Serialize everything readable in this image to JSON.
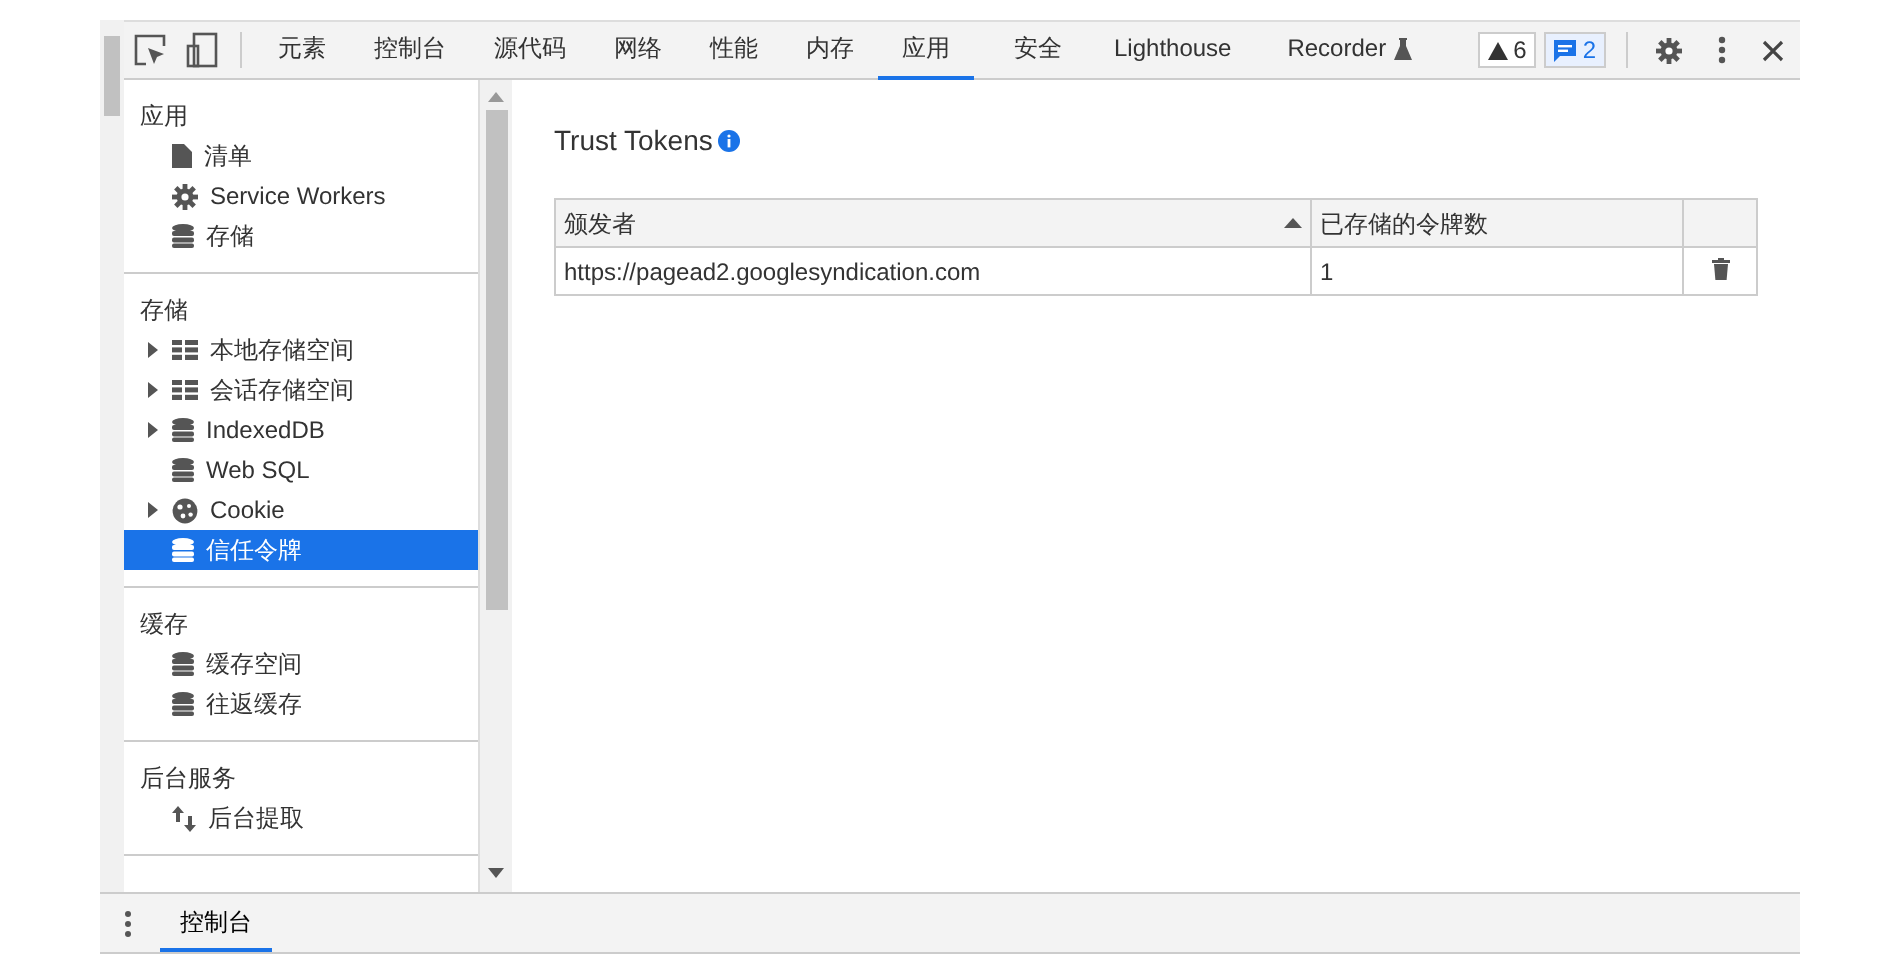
{
  "toolbar": {
    "tabs": [
      {
        "label": "元素",
        "selected": false
      },
      {
        "label": "控制台",
        "selected": false
      },
      {
        "label": "源代码",
        "selected": false
      },
      {
        "label": "网络",
        "selected": false
      },
      {
        "label": "性能",
        "selected": false
      },
      {
        "label": "内存",
        "selected": false
      },
      {
        "label": "应用",
        "selected": true
      },
      {
        "label": "安全",
        "selected": false
      },
      {
        "label": "Lighthouse",
        "selected": false
      },
      {
        "label": "Recorder",
        "selected": false,
        "experimental": true
      }
    ],
    "warnings": "6",
    "messages": "2"
  },
  "sidebar": {
    "sections": [
      {
        "title": "应用",
        "items": [
          {
            "label": "清单",
            "kind": "file",
            "expandable": false,
            "selected": false
          },
          {
            "label": "Service Workers",
            "kind": "gear",
            "expandable": false,
            "selected": false
          },
          {
            "label": "存储",
            "kind": "database",
            "expandable": false,
            "selected": false
          }
        ]
      },
      {
        "title": "存储",
        "items": [
          {
            "label": "本地存储空间",
            "kind": "grid",
            "expandable": true,
            "selected": false
          },
          {
            "label": "会话存储空间",
            "kind": "grid",
            "expandable": true,
            "selected": false
          },
          {
            "label": "IndexedDB",
            "kind": "database",
            "expandable": true,
            "selected": false
          },
          {
            "label": "Web SQL",
            "kind": "database",
            "expandable": false,
            "selected": false
          },
          {
            "label": "Cookie",
            "kind": "cookie",
            "expandable": true,
            "selected": false
          },
          {
            "label": "信任令牌",
            "kind": "database",
            "expandable": false,
            "selected": true
          }
        ]
      },
      {
        "title": "缓存",
        "items": [
          {
            "label": "缓存空间",
            "kind": "database",
            "expandable": false,
            "selected": false
          },
          {
            "label": "往返缓存",
            "kind": "database",
            "expandable": false,
            "selected": false
          }
        ]
      },
      {
        "title": "后台服务",
        "items": [
          {
            "label": "后台提取",
            "kind": "updown",
            "expandable": false,
            "selected": false
          }
        ]
      }
    ]
  },
  "main": {
    "title": "Trust Tokens",
    "table": {
      "columns": [
        {
          "label": "颁发者",
          "sorted": true
        },
        {
          "label": "已存储的令牌数",
          "sorted": false
        }
      ],
      "rows": [
        {
          "cells": [
            "https://pagead2.googlesyndication.com",
            "1"
          ]
        }
      ]
    }
  },
  "drawer": {
    "tabs": [
      {
        "label": "控制台",
        "selected": true
      }
    ]
  }
}
